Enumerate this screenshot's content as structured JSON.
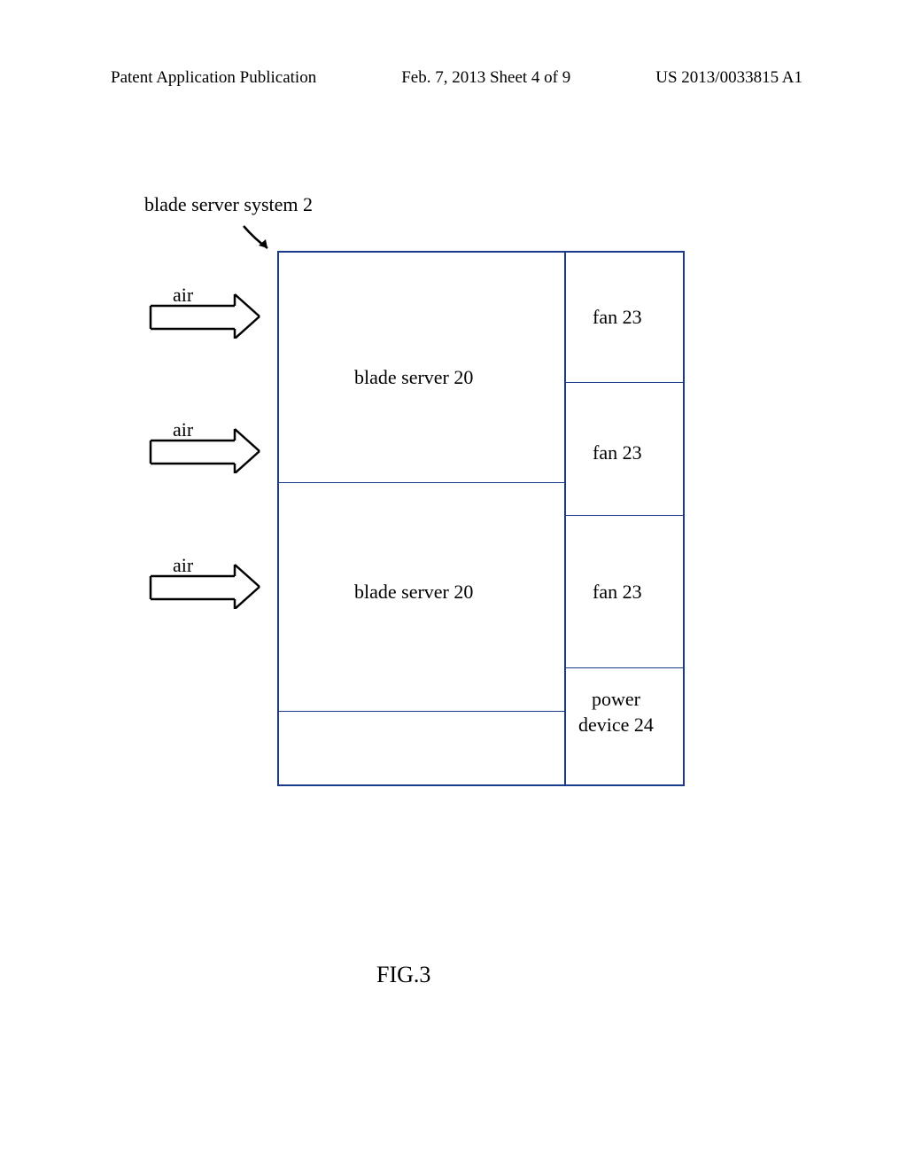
{
  "header": {
    "left": "Patent Application Publication",
    "center": "Feb. 7, 2013   Sheet 4 of 9",
    "right": "US 2013/0033815 A1"
  },
  "system_label": "blade server system 2",
  "air_label": "air",
  "cells": {
    "blade1": "blade server 20",
    "blade2": "blade server 20",
    "fan1": "fan 23",
    "fan2": "fan 23",
    "fan3": "fan 23",
    "power_line1": "power",
    "power_line2": "device 24"
  },
  "figure_label": "FIG.3"
}
